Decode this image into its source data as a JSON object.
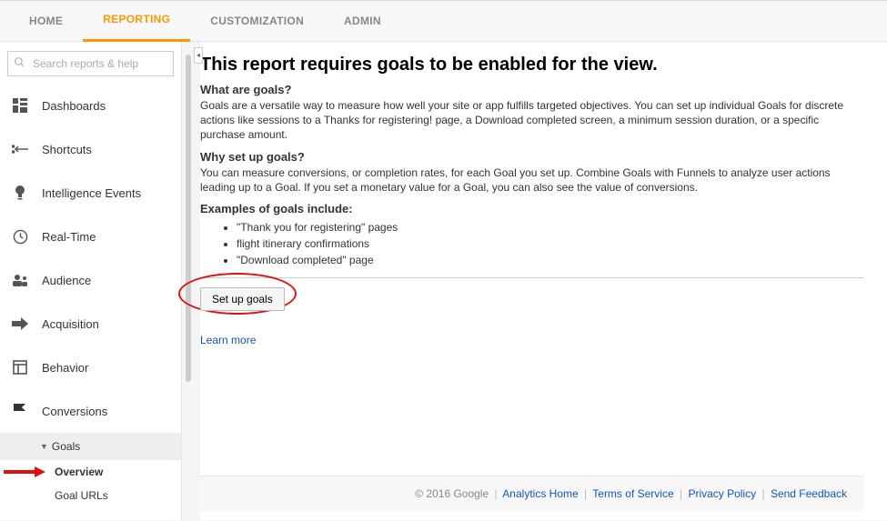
{
  "topnav": {
    "tabs": [
      {
        "label": "HOME"
      },
      {
        "label": "REPORTING"
      },
      {
        "label": "CUSTOMIZATION"
      },
      {
        "label": "ADMIN"
      }
    ],
    "active_index": 1
  },
  "search": {
    "placeholder": "Search reports & help"
  },
  "sidebar": {
    "items": [
      {
        "label": "Dashboards",
        "icon": "dashboard-icon"
      },
      {
        "label": "Shortcuts",
        "icon": "shortcuts-icon"
      },
      {
        "label": "Intelligence Events",
        "icon": "bulb-icon"
      },
      {
        "label": "Real-Time",
        "icon": "clock-icon"
      },
      {
        "label": "Audience",
        "icon": "audience-icon"
      },
      {
        "label": "Acquisition",
        "icon": "acquisition-icon"
      },
      {
        "label": "Behavior",
        "icon": "behavior-icon"
      },
      {
        "label": "Conversions",
        "icon": "flag-icon"
      }
    ],
    "goals_label": "Goals",
    "overview_label": "Overview",
    "goal_urls_label": "Goal URLs"
  },
  "report": {
    "title": "This report requires goals to be enabled for the view.",
    "what_heading": "What are goals?",
    "what_body": "Goals are a versatile way to measure how well your site or app fulfills targeted objectives. You can set up individual Goals for discrete actions like sessions to a Thanks for registering! page, a Download completed screen, a minimum session duration, or a specific purchase amount.",
    "why_heading": "Why set up goals?",
    "why_body": "You can measure conversions, or completion rates, for each Goal you set up. Combine Goals with Funnels to analyze user actions leading up to a Goal. If you set a monetary value for a Goal, you can also see the value of conversions.",
    "examples_heading": "Examples of goals include:",
    "examples": [
      "\"Thank you for registering\" pages",
      "flight itinerary confirmations",
      "\"Download completed\" page"
    ],
    "setup_button": "Set up goals",
    "learn_more": "Learn more"
  },
  "footer": {
    "copyright": "© 2016 Google",
    "links": [
      "Analytics Home",
      "Terms of Service",
      "Privacy Policy",
      "Send Feedback"
    ]
  }
}
